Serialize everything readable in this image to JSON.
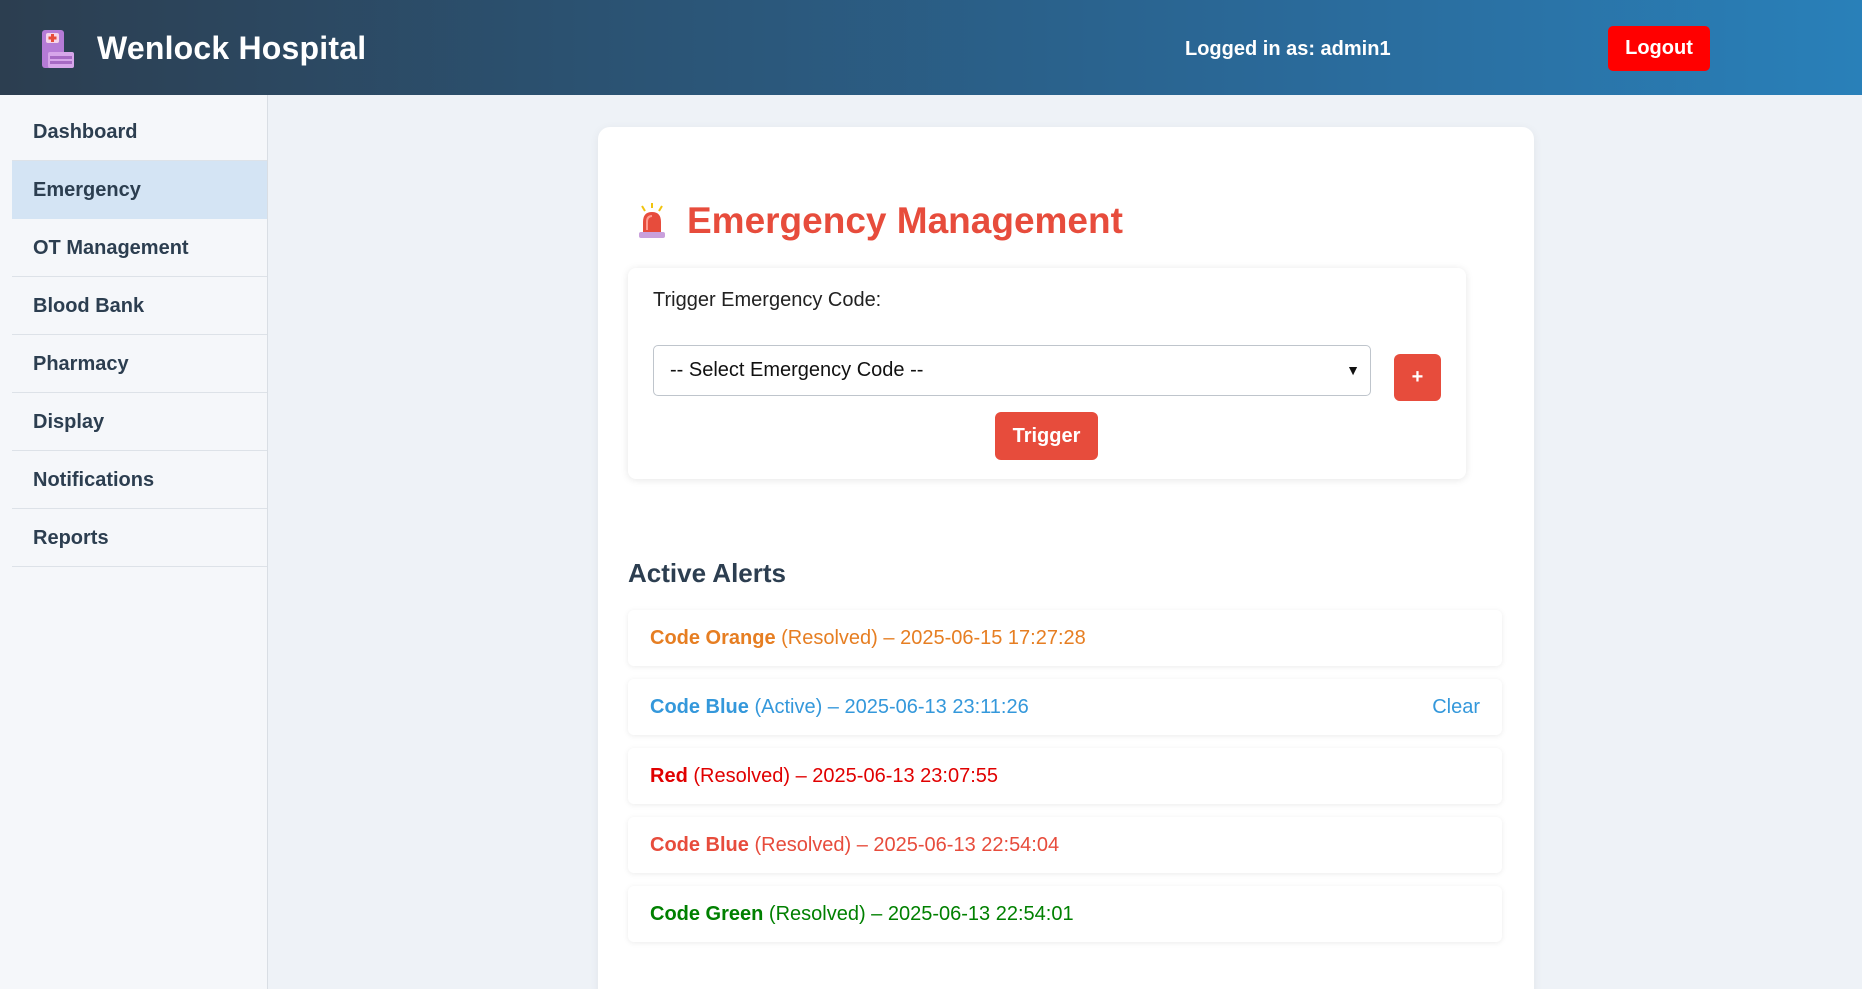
{
  "header": {
    "brand": "Wenlock Hospital",
    "user_label": "Logged in as: admin1",
    "logout_label": "Logout",
    "logo_icon": "hospital-icon"
  },
  "sidebar": {
    "items": [
      {
        "label": "Dashboard",
        "active": false
      },
      {
        "label": "Emergency",
        "active": true
      },
      {
        "label": "OT Management",
        "active": false
      },
      {
        "label": "Blood Bank",
        "active": false
      },
      {
        "label": "Pharmacy",
        "active": false
      },
      {
        "label": "Display",
        "active": false
      },
      {
        "label": "Notifications",
        "active": false
      },
      {
        "label": "Reports",
        "active": false
      }
    ]
  },
  "main": {
    "title": "Emergency Management",
    "title_icon": "siren-icon",
    "trigger": {
      "label": "Trigger Emergency Code:",
      "select_value": "-- Select Emergency Code --",
      "add_label": "+",
      "trigger_label": "Trigger"
    },
    "alerts_title": "Active Alerts",
    "alerts": [
      {
        "code": "Code Orange",
        "rest": " (Resolved) – 2025-06-15 17:27:28",
        "color": "#e67e22",
        "action": ""
      },
      {
        "code": "Code Blue",
        "rest": " (Active) – 2025-06-13 23:11:26",
        "color": "#3498db",
        "action": "Clear"
      },
      {
        "code": "Red",
        "rest": " (Resolved) – 2025-06-13 23:07:55",
        "color": "#e00000",
        "action": ""
      },
      {
        "code": "Code Blue",
        "rest": " (Resolved) – 2025-06-13 22:54:04",
        "color": "#e74c3c",
        "action": ""
      },
      {
        "code": "Code Green",
        "rest": " (Resolved) – 2025-06-13 22:54:01",
        "color": "#008000",
        "action": ""
      }
    ]
  },
  "colors": {
    "accent_red": "#e74c3c",
    "logout_red": "#ff0000",
    "header_start": "#2c3e50",
    "header_end": "#2980b9",
    "active_nav": "#d4e4f4"
  }
}
